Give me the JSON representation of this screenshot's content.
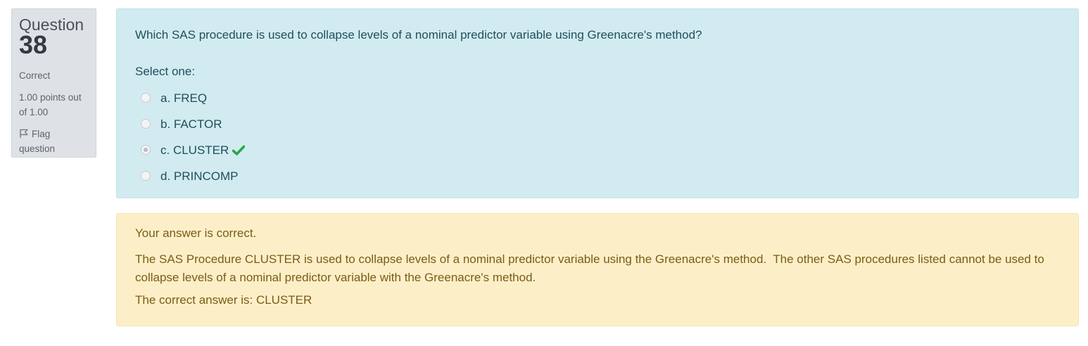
{
  "info": {
    "question_label": "Question",
    "question_number": "38",
    "state": "Correct",
    "grade": "1.00 points out of 1.00",
    "flag_label": "Flag question"
  },
  "question": {
    "text": "Which SAS procedure is used to collapse levels of a nominal predictor variable using Greenacre's method?",
    "prompt": "Select one:",
    "options": [
      {
        "label": "a. FREQ",
        "selected": false
      },
      {
        "label": "b. FACTOR",
        "selected": false
      },
      {
        "label": "c. CLUSTER",
        "selected": true,
        "correct": true
      },
      {
        "label": "d. PRINCOMP",
        "selected": false
      }
    ]
  },
  "feedback": {
    "general": "Your answer is correct.",
    "specific": "The SAS Procedure CLUSTER is used to collapse levels of a nominal predictor variable using the Greenacre's method.  The other SAS procedures listed cannot be used to collapse levels of a nominal predictor variable with the Greenacre's method.",
    "right_answer": "The correct answer is: CLUSTER"
  },
  "icons": {
    "flag": "flag-icon",
    "correct": "check-icon"
  },
  "colors": {
    "question_bg": "#d2ebf0",
    "feedback_bg": "#fcefc8",
    "info_bg": "#dee2e6",
    "correct_check": "#28a745"
  }
}
